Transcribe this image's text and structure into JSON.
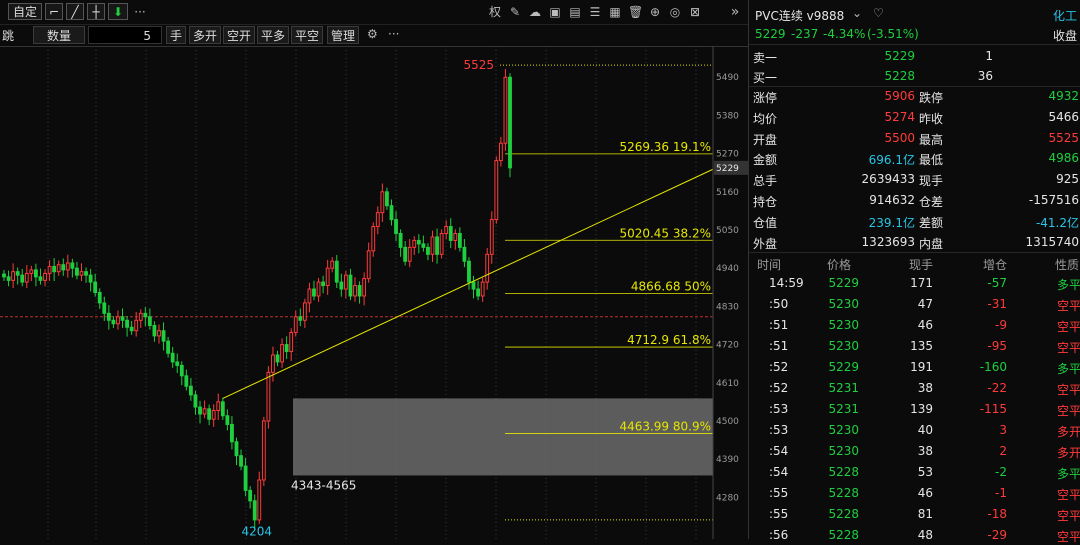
{
  "toolbar": {
    "zoom_label": "自定",
    "more_label": "···",
    "jump_label": "跳",
    "qty_label": "数量",
    "qty_value": "5",
    "hand_label": "手",
    "buttons": [
      "多开",
      "空开",
      "平多",
      "平空",
      "管理"
    ],
    "right_icons": [
      "权",
      "pencil",
      "cloud",
      "image",
      "list",
      "trash",
      "target",
      "timer",
      "close"
    ],
    "collapse": "»"
  },
  "colors": {
    "up": "#ff3b3b",
    "down": "#1fcf3f",
    "fib": "#e6e600",
    "background": "#0b0b0b",
    "zone": "#6b6b6b"
  },
  "chart_data": {
    "type": "candlestick",
    "ylim": [
      4160,
      5580
    ],
    "yticks": [
      5490,
      5380,
      5270,
      5160,
      5050,
      4940,
      4830,
      4720,
      4610,
      4500,
      4390,
      4280
    ],
    "last_price": 5229,
    "high_label": "5525",
    "low_label": "4204",
    "dotted_level": 5525,
    "bottom_dotted_level": 4215,
    "red_ref_level": 4800,
    "fib_levels": [
      {
        "price": 5269.36,
        "label": "5269.36 19.1%"
      },
      {
        "price": 5020.45,
        "label": "5020.45 38.2%"
      },
      {
        "price": 4866.68,
        "label": "4866.68 50%"
      },
      {
        "price": 4712.9,
        "label": "4712.9 61.8%"
      },
      {
        "price": 4463.99,
        "label": "4463.99 80.9%"
      }
    ],
    "zone": {
      "top": 4565,
      "bottom": 4343,
      "label": "4343-4565"
    },
    "trendline": {
      "from": {
        "i": 48,
        "p": 4565
      },
      "to": {
        "i": 108,
        "p": 5225
      }
    },
    "closes": [
      4915,
      4905,
      4930,
      4920,
      4900,
      4925,
      4935,
      4915,
      4905,
      4925,
      4945,
      4930,
      4950,
      4935,
      4955,
      4940,
      4920,
      4930,
      4920,
      4900,
      4870,
      4840,
      4810,
      4790,
      4780,
      4800,
      4790,
      4770,
      4760,
      4790,
      4810,
      4800,
      4775,
      4745,
      4760,
      4730,
      4695,
      4670,
      4660,
      4630,
      4600,
      4575,
      4540,
      4520,
      4535,
      4505,
      4530,
      4555,
      4515,
      4490,
      4440,
      4400,
      4370,
      4300,
      4270,
      4215,
      4330,
      4500,
      4640,
      4690,
      4670,
      4720,
      4700,
      4755,
      4800,
      4790,
      4840,
      4880,
      4860,
      4900,
      4890,
      4940,
      4960,
      4900,
      4880,
      4920,
      4860,
      4890,
      4860,
      4910,
      4990,
      5060,
      5100,
      5160,
      5120,
      5080,
      5040,
      5000,
      4960,
      5000,
      5020,
      5010,
      5000,
      4980,
      5030,
      4980,
      5040,
      5060,
      5020,
      5040,
      5000,
      4960,
      4900,
      4880,
      4860,
      4900,
      4980,
      5080,
      5250,
      5300,
      5490,
      5229
    ]
  },
  "panel": {
    "symbol": "PVC连续 v9888",
    "category": "化工",
    "price": "5229",
    "change": "-237",
    "change_pct": "-4.34%",
    "change_pct2": "(-3.51%)",
    "close_label": "收盘",
    "ask": {
      "label": "卖一",
      "price": "5229",
      "vol": "1"
    },
    "bid": {
      "label": "买一",
      "price": "5228",
      "vol": "36"
    },
    "stats": [
      {
        "l1": "涨停",
        "v1": "5906",
        "c1": "red",
        "l2": "跌停",
        "v2": "4932",
        "c2": "green"
      },
      {
        "l1": "均价",
        "v1": "5274",
        "c1": "red",
        "l2": "昨收",
        "v2": "5466",
        "c2": "white"
      },
      {
        "l1": "开盘",
        "v1": "5500",
        "c1": "red",
        "l2": "最高",
        "v2": "5525",
        "c2": "red"
      },
      {
        "l1": "金额",
        "v1": "696.1亿",
        "c1": "cyan",
        "l2": "最低",
        "v2": "4986",
        "c2": "green"
      },
      {
        "l1": "总手",
        "v1": "2639433",
        "c1": "white",
        "l2": "现手",
        "v2": "925",
        "c2": "white"
      },
      {
        "l1": "持仓",
        "v1": "914632",
        "c1": "white",
        "l2": "仓差",
        "v2": "-157516",
        "c2": "white"
      },
      {
        "l1": "仓值",
        "v1": "239.1亿",
        "c1": "cyan",
        "l2": "差额",
        "v2": "-41.2亿",
        "c2": "cyan"
      },
      {
        "l1": "外盘",
        "v1": "1323693",
        "c1": "white",
        "l2": "内盘",
        "v2": "1315740",
        "c2": "white"
      }
    ],
    "tick_headers": [
      "时间",
      "价格",
      "现手",
      "增仓",
      "性质"
    ],
    "ticks": [
      {
        "t": "14:59",
        "p": "5229",
        "v": "171",
        "d": "-57",
        "n": "多平",
        "nc": "green",
        "dc": "green"
      },
      {
        "t": ":50",
        "p": "5230",
        "v": "47",
        "d": "-31",
        "n": "空平",
        "nc": "red",
        "dc": "red"
      },
      {
        "t": ":51",
        "p": "5230",
        "v": "46",
        "d": "-9",
        "n": "空平",
        "nc": "red",
        "dc": "red"
      },
      {
        "t": ":51",
        "p": "5230",
        "v": "135",
        "d": "-95",
        "n": "空平",
        "nc": "red",
        "dc": "red"
      },
      {
        "t": ":52",
        "p": "5229",
        "v": "191",
        "d": "-160",
        "n": "多平",
        "nc": "green",
        "dc": "green"
      },
      {
        "t": ":52",
        "p": "5231",
        "v": "38",
        "d": "-22",
        "n": "空平",
        "nc": "red",
        "dc": "red"
      },
      {
        "t": ":53",
        "p": "5231",
        "v": "139",
        "d": "-115",
        "n": "空平",
        "nc": "red",
        "dc": "red"
      },
      {
        "t": ":53",
        "p": "5230",
        "v": "40",
        "d": "3",
        "n": "多开",
        "nc": "red",
        "dc": "red"
      },
      {
        "t": ":54",
        "p": "5230",
        "v": "38",
        "d": "2",
        "n": "多开",
        "nc": "red",
        "dc": "red"
      },
      {
        "t": ":54",
        "p": "5228",
        "v": "53",
        "d": "-2",
        "n": "多平",
        "nc": "green",
        "dc": "green"
      },
      {
        "t": ":55",
        "p": "5228",
        "v": "46",
        "d": "-1",
        "n": "空平",
        "nc": "red",
        "dc": "red"
      },
      {
        "t": ":55",
        "p": "5228",
        "v": "81",
        "d": "-18",
        "n": "空平",
        "nc": "red",
        "dc": "red"
      },
      {
        "t": ":56",
        "p": "5228",
        "v": "48",
        "d": "-29",
        "n": "空平",
        "nc": "red",
        "dc": "red"
      }
    ]
  }
}
